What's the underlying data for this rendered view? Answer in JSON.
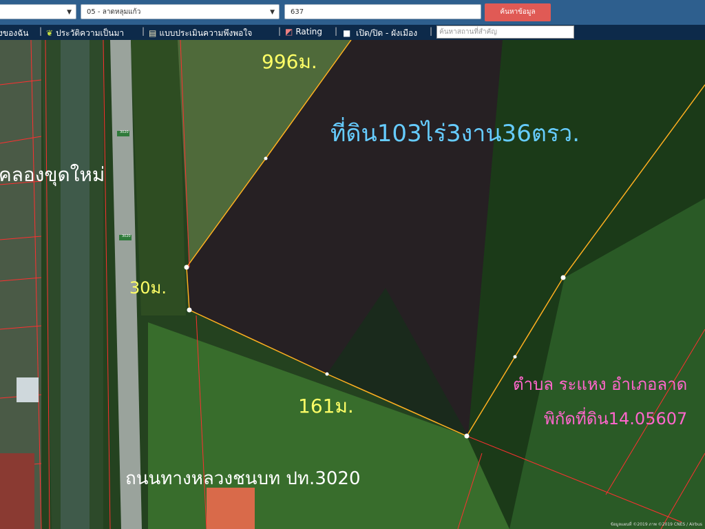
{
  "header": {
    "select_left": "",
    "select_district": "05 - ลาดหลุมแก้ว",
    "parcel_number": "637",
    "search_button": "ค้นหาข้อมูล"
  },
  "menu": {
    "items": [
      {
        "label": "งของฉัน"
      },
      {
        "label": "ประวัติความเป็นมา"
      },
      {
        "label": "แบบประเมินความพึงพอใจ"
      },
      {
        "label": "Rating"
      },
      {
        "label": "เปิด/ปิด - ผังเมือง"
      }
    ],
    "place_search_placeholder": "ค้นหาสถานที่สำคัญ"
  },
  "map": {
    "labels": {
      "side_top": "996ม.",
      "side_left": "30ม.",
      "side_bottom": "161ม.",
      "area": "ที่ดิน103ไร่3งาน36ตรว.",
      "canal": "คลองขุดใหม่",
      "road": "ถนนทางหลวงชนบท ปท.3020",
      "subdistrict": "ตำบล ระแหง อำเภอลาด",
      "coordinates": "พิกัดที่ดิน14.05607"
    },
    "road_markers": [
      "3020",
      "3020"
    ],
    "attribution": "ข้อมูลแผนที่ ©2019 ภาพ ©2019 CNES / Airbus"
  },
  "colors": {
    "top_bar": "#2e5f8e",
    "menu_bar": "#0d2a4a",
    "search_button": "#e05a55",
    "parcel_line": "#ffb020",
    "boundary_line": "#ff3030",
    "side_label": "#ffff66",
    "area_label": "#66ccff",
    "subdistrict_label": "#ff66cc"
  },
  "icons": [
    "dropdown-caret-icon",
    "sprout-icon",
    "document-icon",
    "rating-chart-icon",
    "toggle-square-icon"
  ]
}
